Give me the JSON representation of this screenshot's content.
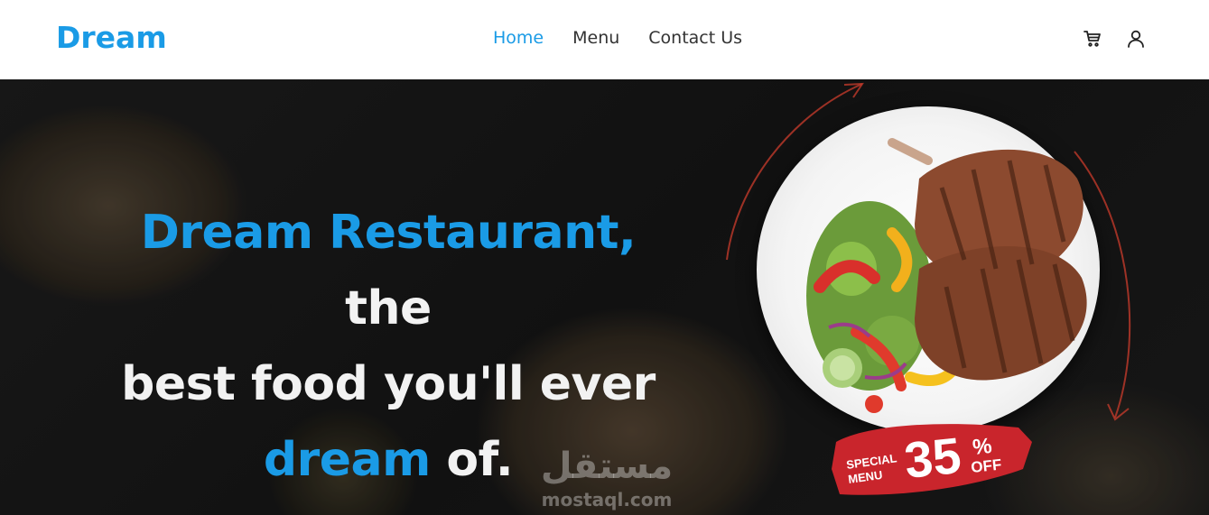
{
  "navbar": {
    "brand": "Dream",
    "links": [
      {
        "label": "Home",
        "active": true
      },
      {
        "label": "Menu",
        "active": false
      },
      {
        "label": "Contact Us",
        "active": false
      }
    ],
    "icons": [
      "cart-icon",
      "user-icon"
    ]
  },
  "hero": {
    "title_highlight_1": "Dream Restaurant,",
    "title_part_1": " the",
    "title_part_2": "best food you'll ever",
    "title_highlight_2": "dream",
    "title_part_3": " of."
  },
  "promo": {
    "special": "SPECIAL",
    "menu": "MENU",
    "amount": "35",
    "percent": "%",
    "off": "OFF"
  },
  "watermark": {
    "arabic": "مستقل",
    "latin": "mostaql.com"
  },
  "colors": {
    "accent": "#1a9be6",
    "promo_red": "#c9252c"
  }
}
